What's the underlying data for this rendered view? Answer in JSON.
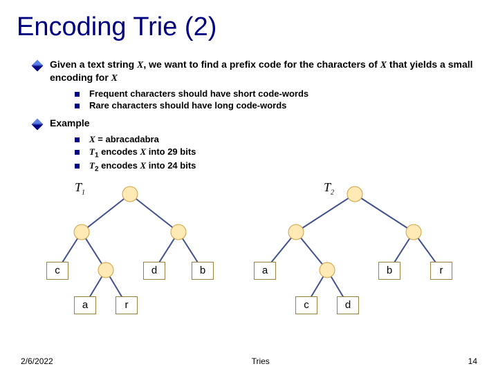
{
  "title": "Encoding Trie (2)",
  "bullets": [
    {
      "text_before": "Given a text string ",
      "var1": "X",
      "text_mid": ", we want to find a prefix code for the characters of ",
      "var2": "X",
      "text_after": " that yields a small encoding for ",
      "var3": "X",
      "subs": [
        "Frequent characters should have short code-words",
        "Rare characters should have long code-words"
      ]
    },
    {
      "text": "Example",
      "subs_rich": [
        {
          "var": "X",
          "eq": " = ",
          "val": "abracadabra"
        },
        {
          "var": "T",
          "sub": "1",
          "mid": " encodes ",
          "var2": "X",
          "after": " into ",
          "num": "29",
          "unit": " bits"
        },
        {
          "var": "T",
          "sub": "2",
          "mid": " encodes ",
          "var2": "X",
          "after": " into ",
          "num": "24",
          "unit": " bits"
        }
      ]
    }
  ],
  "tree1": {
    "label": "T",
    "sub": "1",
    "leaves": [
      "c",
      "d",
      "b",
      "a",
      "r"
    ]
  },
  "tree2": {
    "label": "T",
    "sub": "2",
    "leaves": [
      "a",
      "b",
      "r",
      "c",
      "d"
    ]
  },
  "footer": {
    "date": "2/6/2022",
    "center": "Tries",
    "page": "14"
  }
}
